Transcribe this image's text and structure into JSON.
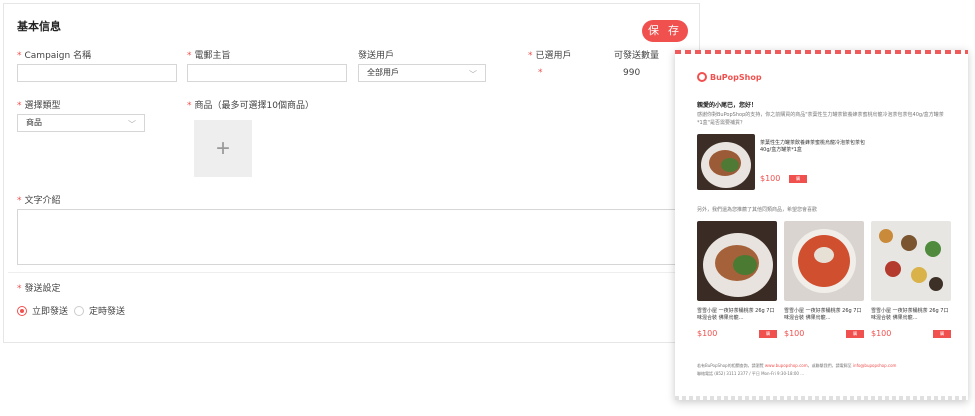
{
  "form": {
    "title": "基本信息",
    "save_label": "保 存",
    "campaign_label": "Campaign 名稱",
    "subject_label": "電郵主旨",
    "send_to_label": "發送用戶",
    "send_to_value": "全部用戶",
    "selected_label": "已選用戶",
    "selected_value": "*",
    "sendable_label": "可發送數量",
    "sendable_value": "990",
    "type_label": "選擇類型",
    "type_value": "商品",
    "products_label": "商品（最多可選擇10個商品）",
    "upload_symbol": "+",
    "description_label": "文字介紹",
    "send_setting_label": "發送設定",
    "send_options": [
      {
        "label": "立即發送",
        "selected": true
      },
      {
        "label": "定時發送",
        "selected": false
      }
    ]
  },
  "preview": {
    "brand": "BuPopShop",
    "greeting": "親愛的小尾巴，您好！",
    "intro": "感謝你對BuPopShop的支持，你之前購買的商品\"茶葉性生力罐茶飲養蜂茶蜜桃烏龍冷泡茶包茶包40g/盒方罐茶*1盒\"是否需要補貨？",
    "main_product": {
      "name": "茶葉性生力罐茶飲養蜂茶蜜桃烏龍冷泡茶包茶包40g/盒方罐茶*1盒",
      "price": "$100",
      "buy_label": "購"
    },
    "recommend_text": "另外，我們還為您推薦了其他同類商品，希望您會喜歡",
    "recommendations": [
      {
        "name": "雪雪小屋 一夜好茶桶桃茶 26g 7口味混合裝 佛果烏龍…",
        "price": "$100",
        "buy_label": "購"
      },
      {
        "name": "雪雪小屋 一夜好茶桶桃茶 26g 7口味混合裝 佛果烏龍…",
        "price": "$100",
        "buy_label": "購"
      },
      {
        "name": "雪雪小屋 一夜好茶桶桃茶 26g 7口味混合裝 佛果烏龍…",
        "price": "$100",
        "buy_label": "購"
      }
    ],
    "footer_text": "若有BuPopShop的相關查詢，請瀏覽",
    "footer_link": "www.bupopshop.com",
    "footer_text2": "，或聯繫我們，請電郵至",
    "footer_email": "info@bupopshop.com",
    "footer_contact": "聯絡電話 (852) 3111 2377 / 平日 Mon-Fri 9:30-18:00 ..."
  },
  "colors": {
    "accent": "#f0514f"
  }
}
